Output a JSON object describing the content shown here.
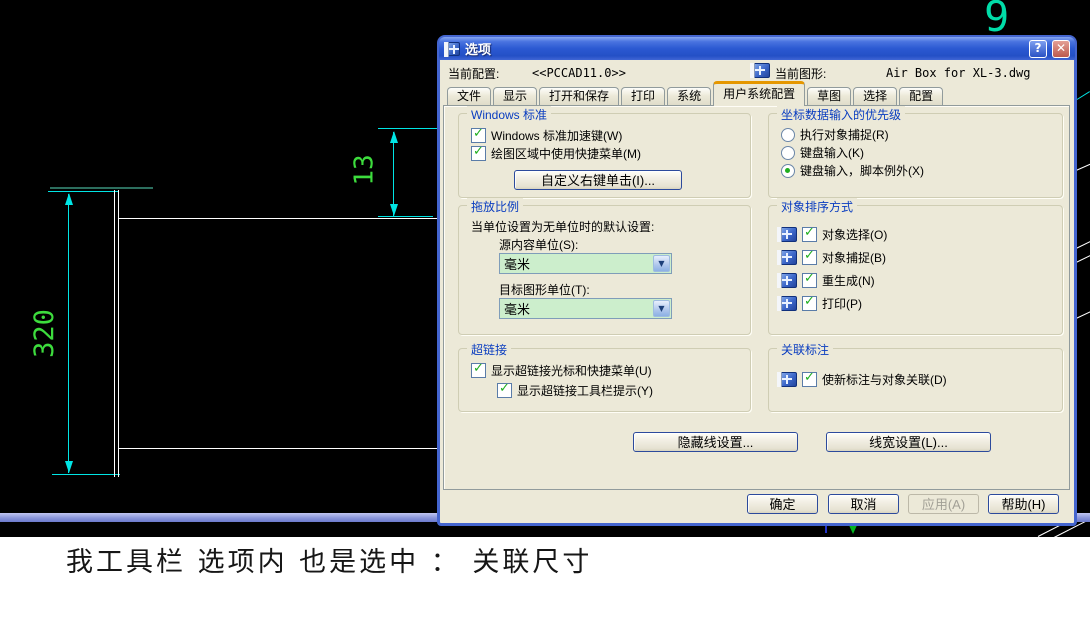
{
  "cad": {
    "dim_vertical": "320",
    "dim_offset": "13",
    "stray_text": "9",
    "colors": {
      "dimension_line": "#00e5e5",
      "dimension_text": "#3ddc3d",
      "geometry": "#ffffff",
      "background": "#000000"
    }
  },
  "caption_text": "我工具栏 选项内 也是选中 ：  关联尺寸",
  "icons": {
    "check": "✓",
    "combo_arrow": "▼",
    "help_glyph": "?",
    "close_glyph": "✕"
  },
  "dialog": {
    "title": "选项",
    "config_bar": {
      "current_config_label": "当前配置:",
      "current_config_value": "<<PCCAD11.0>>",
      "current_drawing_label": "当前图形:",
      "current_drawing_value": "Air Box for XL-3.dwg"
    },
    "tabs": [
      "文件",
      "显示",
      "打开和保存",
      "打印",
      "系统",
      "用户系统配置",
      "草图",
      "选择",
      "配置"
    ],
    "active_tab": "用户系统配置",
    "windows_standard": {
      "title": "Windows 标准",
      "checkbox_accel": "Windows 标准加速键(W)",
      "checkbox_shortcut_menu": "绘图区域中使用快捷菜单(M)",
      "customize_right_click_button": "自定义右键单击(I)..."
    },
    "drag_scale": {
      "title": "拖放比例",
      "description": "当单位设置为无单位时的默认设置:",
      "source_units_label": "源内容单位(S):",
      "source_units_value": "毫米",
      "target_units_label": "目标图形单位(T):",
      "target_units_value": "毫米"
    },
    "hyperlink": {
      "title": "超链接",
      "checkbox_cursor_menu": "显示超链接光标和快捷菜单(U)",
      "checkbox_tooltip": "显示超链接工具栏提示(Y)"
    },
    "coord_priority": {
      "title": "坐标数据输入的优先级",
      "radio_osnap": "执行对象捕捉(R)",
      "radio_keyboard": "键盘输入(K)",
      "radio_keyboard_script": "键盘输入，脚本例外(X)",
      "selected": "键盘输入，脚本例外(X)"
    },
    "object_sort": {
      "title": "对象排序方式",
      "item_select": "对象选择(O)",
      "item_snap": "对象捕捉(B)",
      "item_regen": "重生成(N)",
      "item_plot": "打印(P)"
    },
    "assoc_dim": {
      "title": "关联标注",
      "checkbox_assoc": "使新标注与对象关联(D)"
    },
    "hidden_line_button": "隐藏线设置...",
    "lineweight_button": "线宽设置(L)...",
    "ok_button": "确定",
    "cancel_button": "取消",
    "apply_button": "应用(A)",
    "help_button": "帮助(H)"
  }
}
